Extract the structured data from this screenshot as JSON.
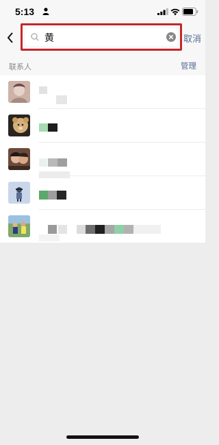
{
  "status_bar": {
    "time": "5:13",
    "icons": [
      "person-icon",
      "signal-icon",
      "wifi-icon",
      "battery-icon"
    ]
  },
  "search": {
    "query": "黄",
    "cancel_label": "取消",
    "highlight_color": "#c4272a",
    "icons": [
      "back-icon",
      "search-icon",
      "clear-icon"
    ]
  },
  "contacts_section": {
    "title": "联系人",
    "manage_label": "管理"
  },
  "contacts": {
    "count_shown": 5,
    "names_redacted": true
  },
  "colors": {
    "link": "#576b95",
    "background": "#ededed",
    "list_background": "#ffffff"
  }
}
